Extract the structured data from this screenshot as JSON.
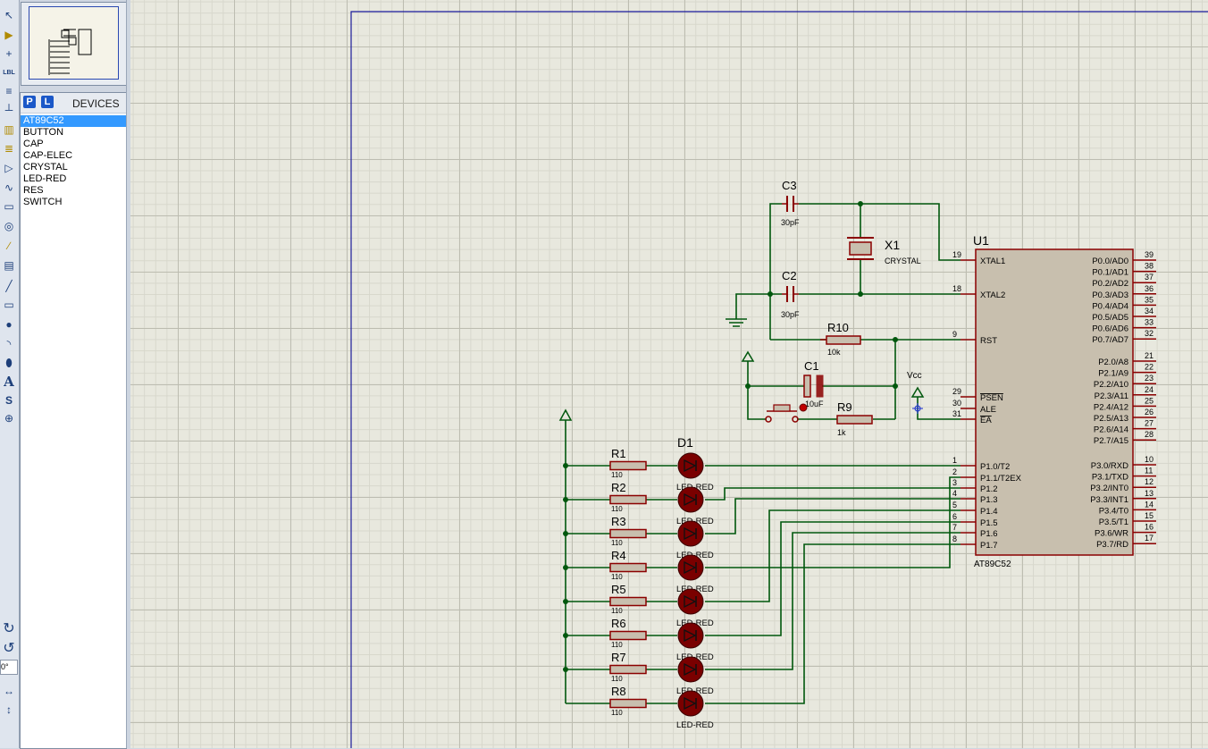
{
  "devices_panel": {
    "p_button": "P",
    "l_button": "L",
    "title": "DEVICES",
    "items": [
      "AT89C52",
      "BUTTON",
      "CAP",
      "CAP-ELEC",
      "CRYSTAL",
      "LED-RED",
      "RES",
      "SWITCH"
    ],
    "selected": "AT89C52"
  },
  "toolbar": {
    "lbl_label": "LBL",
    "text_tool": "A",
    "symbol_tool": "S",
    "rotation_value": "0°",
    "icons": [
      "select-arrow-icon",
      "component-icon",
      "junction-icon",
      "label-icon",
      "script-icon",
      "bus-icon",
      "subcircuit-icon",
      "terminal-icon",
      "pin-icon",
      "graph-icon",
      "tape-icon",
      "generator-icon",
      "probe-icon",
      "instrument-icon",
      "line-icon",
      "box-icon",
      "circle-icon",
      "arc-icon",
      "path-icon",
      "text-icon",
      "symbol-icon",
      "marker-icon",
      "rotate-cw-icon",
      "rotate-ccw-icon",
      "mirror-h-icon",
      "mirror-v-icon"
    ]
  },
  "schematic": {
    "u1": {
      "ref": "U1",
      "part": "AT89C52",
      "left_pins": [
        {
          "num": "19",
          "name": "XTAL1"
        },
        {
          "num": "18",
          "name": "XTAL2"
        },
        {
          "num": "9",
          "name": "RST"
        },
        {
          "num": "29",
          "name": "PSEN"
        },
        {
          "num": "30",
          "name": "ALE"
        },
        {
          "num": "31",
          "name": "EA"
        },
        {
          "num": "1",
          "name": "P1.0/T2"
        },
        {
          "num": "2",
          "name": "P1.1/T2EX"
        },
        {
          "num": "3",
          "name": "P1.2"
        },
        {
          "num": "4",
          "name": "P1.3"
        },
        {
          "num": "5",
          "name": "P1.4"
        },
        {
          "num": "6",
          "name": "P1.5"
        },
        {
          "num": "7",
          "name": "P1.6"
        },
        {
          "num": "8",
          "name": "P1.7"
        }
      ],
      "right_pins": [
        {
          "num": "39",
          "name": "P0.0/AD0"
        },
        {
          "num": "38",
          "name": "P0.1/AD1"
        },
        {
          "num": "37",
          "name": "P0.2/AD2"
        },
        {
          "num": "36",
          "name": "P0.3/AD3"
        },
        {
          "num": "35",
          "name": "P0.4/AD4"
        },
        {
          "num": "34",
          "name": "P0.5/AD5"
        },
        {
          "num": "33",
          "name": "P0.6/AD6"
        },
        {
          "num": "32",
          "name": "P0.7/AD7"
        },
        {
          "num": "21",
          "name": "P2.0/A8"
        },
        {
          "num": "22",
          "name": "P2.1/A9"
        },
        {
          "num": "23",
          "name": "P2.2/A10"
        },
        {
          "num": "24",
          "name": "P2.3/A11"
        },
        {
          "num": "25",
          "name": "P2.4/A12"
        },
        {
          "num": "26",
          "name": "P2.5/A13"
        },
        {
          "num": "27",
          "name": "P2.6/A14"
        },
        {
          "num": "28",
          "name": "P2.7/A15"
        },
        {
          "num": "10",
          "name": "P3.0/RXD"
        },
        {
          "num": "11",
          "name": "P3.1/TXD"
        },
        {
          "num": "12",
          "name": "P3.2/INT0"
        },
        {
          "num": "13",
          "name": "P3.3/INT1"
        },
        {
          "num": "14",
          "name": "P3.4/T0"
        },
        {
          "num": "15",
          "name": "P3.5/T1"
        },
        {
          "num": "16",
          "name": "P3.6/WR"
        },
        {
          "num": "17",
          "name": "P3.7/RD"
        }
      ]
    },
    "c3": {
      "ref": "C3",
      "value": "30pF"
    },
    "c2": {
      "ref": "C2",
      "value": "30pF"
    },
    "x1": {
      "ref": "X1",
      "value": "CRYSTAL"
    },
    "r10": {
      "ref": "R10",
      "value": "10k"
    },
    "c1": {
      "ref": "C1",
      "value": "10uF"
    },
    "r9": {
      "ref": "R9",
      "value": "1k"
    },
    "vcc_label": "Vcc",
    "d1_ref": "D1",
    "resistors": [
      {
        "ref": "R1",
        "value": "110"
      },
      {
        "ref": "R2",
        "value": "110"
      },
      {
        "ref": "R3",
        "value": "110"
      },
      {
        "ref": "R4",
        "value": "110"
      },
      {
        "ref": "R5",
        "value": "110"
      },
      {
        "ref": "R6",
        "value": "110"
      },
      {
        "ref": "R7",
        "value": "110"
      },
      {
        "ref": "R8",
        "value": "110"
      }
    ],
    "led_label": "LED-RED"
  }
}
